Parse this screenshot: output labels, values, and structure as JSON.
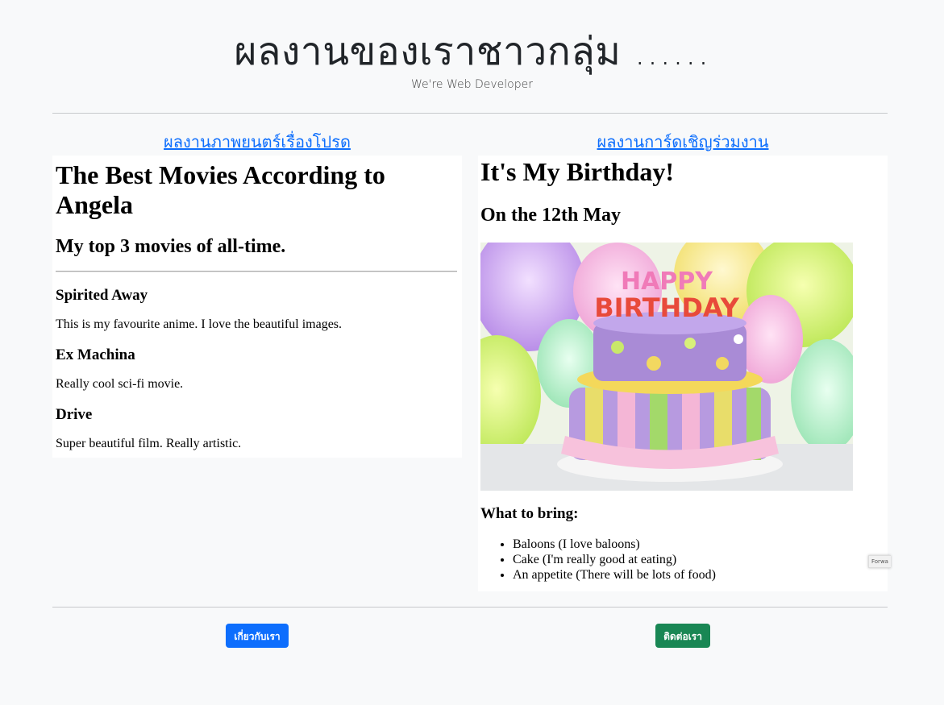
{
  "header": {
    "title": "ผลงานของเราชาวกลุ่ม ......",
    "subtitle": "We're Web Developer"
  },
  "links": {
    "left": "ผลงานภาพยนตร์เรื่องโปรด",
    "right": "ผลงานการ์ดเชิญร่วมงาน"
  },
  "movies": {
    "title": "The Best Movies According to Angela",
    "subtitle": "My top 3 movies of all-time.",
    "items": [
      {
        "name": "Spirited Away",
        "desc": "This is my favourite anime. I love the beautiful images."
      },
      {
        "name": "Ex Machina",
        "desc": "Really cool sci-fi movie."
      },
      {
        "name": "Drive",
        "desc": "Super beautiful film. Really artistic."
      }
    ]
  },
  "birthday": {
    "title": "It's My Birthday!",
    "date": "On the 12th May",
    "bring_heading": "What to bring:",
    "bring_items": [
      "Baloons (I love baloons)",
      "Cake (I'm really good at eating)",
      "An appetite (There will be lots of food)"
    ],
    "image_text": "HAPPY BIRTHDAY"
  },
  "forward_tab": "Forwa",
  "buttons": {
    "about": "เกี่ยวกับเรา",
    "contact": "ติดต่อเรา"
  },
  "colors": {
    "primary": "#0d6efd",
    "success": "#198754",
    "background": "#f8f9fa"
  }
}
